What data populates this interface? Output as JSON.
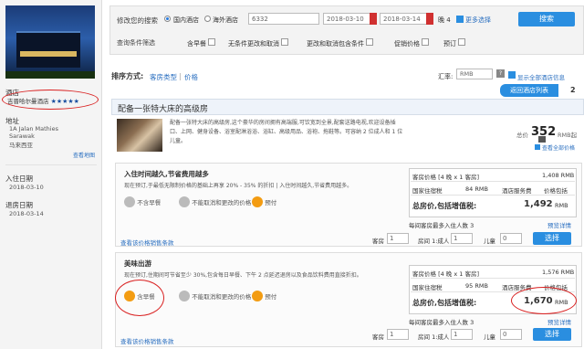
{
  "sidebar": {
    "hotel_label": "酒店",
    "hotel_name": "吉晋哈尔曼酒店",
    "stars": "★★★★★",
    "address_label": "地址",
    "address_lines": [
      "1A Jalan Mathies",
      "Sarawak",
      "马来西亚"
    ],
    "map_link": "查看地图",
    "checkin_label": "入住日期",
    "checkin_date": "2018-03-10",
    "checkout_label": "退房日期",
    "checkout_date": "2018-03-14"
  },
  "search": {
    "modify_label": "修改您的搜索",
    "domestic_label": "国内酒店",
    "overseas_label": "海外酒店",
    "city_value": "6332",
    "checkin": "2018-03-10",
    "checkout": "2018-03-14",
    "nights": "晚 4",
    "more_options": "更多选择",
    "search_button": "搜索",
    "filter_label": "查询条件筛选",
    "filters": [
      "含早餐",
      "无条件更改和取消",
      "更改和取消包含条件",
      "促销价格",
      "预订"
    ]
  },
  "sortbar": {
    "sort_label": "排序方式:",
    "sort_option1": "客房类型",
    "sort_option2": "价格",
    "rate_label": "汇率:",
    "currency": "RMB",
    "show_all": "显示全部酒店信息",
    "back_list": "返回酒店列表",
    "page": "2"
  },
  "room": {
    "title": "配备一张特大床的高级房",
    "description": "配备一张特大床的高级房,这个豪华的房间拥有高端服,可饮宽到全景,配套送路电视,欢迎设备插口、上网、健身设备、浴室配淋浴浴、浴缸、高级用品、浴袍、拖鞋等。可容纳 2 位成人和 1 位儿童。",
    "total_label": "总价",
    "total_price": "352",
    "total_unit": "RMB起",
    "collapse_link": "查看全部价格"
  },
  "offers": [
    {
      "title": "入住时间越久,节省费用越多",
      "desc": "现在预订,于最低无限制价格的基础上再享 20% - 35% 的折扣 | 入住时间越久,节省费用越多。",
      "tag1": "不含早餐",
      "tag2": "不能取消和更改的价格",
      "tag3": "预付",
      "price_header": "客房价格 [4 晚 x 1 客房]",
      "price_header_val": "1,408 RMB",
      "tax_label": "国家住宿税",
      "tax_val": "84 RMB",
      "service_label": "酒店服务费",
      "service_val": "价格包括",
      "total_label": "总房价,包括增值税:",
      "total_val": "1,492",
      "total_unit": "RMB",
      "occupancy": "每间客房最多入住人数 3",
      "detail_link": "预览详情",
      "rooms_label": "客房",
      "rooms_val": "1",
      "adults_label": "房间 1:成人",
      "adults_val": "1",
      "children_label": "儿童",
      "children_val": "0",
      "select_button": "选择",
      "more_link": "查看该价格销售条款"
    },
    {
      "title": "美味出游",
      "desc": "现在预订,住期间可节省至少 30%,包含每日早餐、下午 2 点延迟退房以及食品饮料费用直接折扣。",
      "tag1": "含早餐",
      "tag2": "不能取消和更改的价格",
      "tag3": "预付",
      "price_header": "客房价格 [4 晚 x 1 客房]",
      "price_header_val": "1,576 RMB",
      "tax_label": "国家住宿税",
      "tax_val": "95 RMB",
      "service_label": "酒店服务费",
      "service_val": "价格包括",
      "total_label": "总房价,包括增值税:",
      "total_val": "1,670",
      "total_unit": "RMB",
      "occupancy": "每间客房最多入住人数 3",
      "detail_link": "预览详情",
      "rooms_label": "客房",
      "rooms_val": "1",
      "adults_label": "房间 1:成人",
      "adults_val": "1",
      "children_label": "儿童",
      "children_val": "0",
      "select_button": "选择",
      "more_link": "查看该价格销售条款"
    }
  ]
}
